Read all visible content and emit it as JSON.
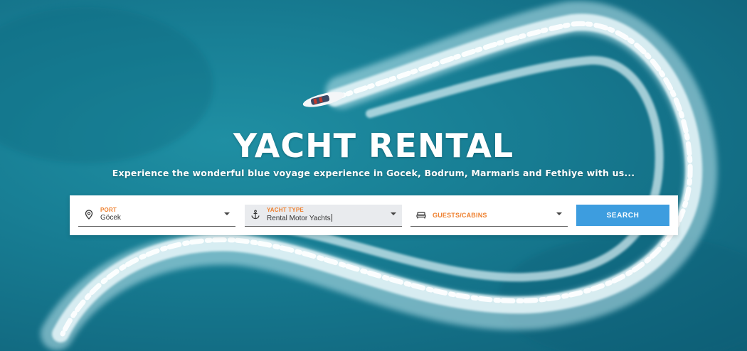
{
  "hero": {
    "title": "YACHT RENTAL",
    "subtitle": "Experience the wonderful blue voyage experience in Gocek, Bodrum, Marmaris and Fethiye with us..."
  },
  "search": {
    "port": {
      "label": "PORT",
      "value": "Göcek",
      "icon": "map-pin-icon"
    },
    "yacht_type": {
      "label": "YACHT TYPE",
      "value": "Rental Motor Yachts",
      "icon": "anchor-icon"
    },
    "guests": {
      "label": "GUESTS/CABINS",
      "icon": "bed-icon"
    },
    "button_label": "SEARCH"
  },
  "colors": {
    "accent_label": "#ee7f2d",
    "button": "#3d9ddf",
    "sea": "#187f95"
  }
}
